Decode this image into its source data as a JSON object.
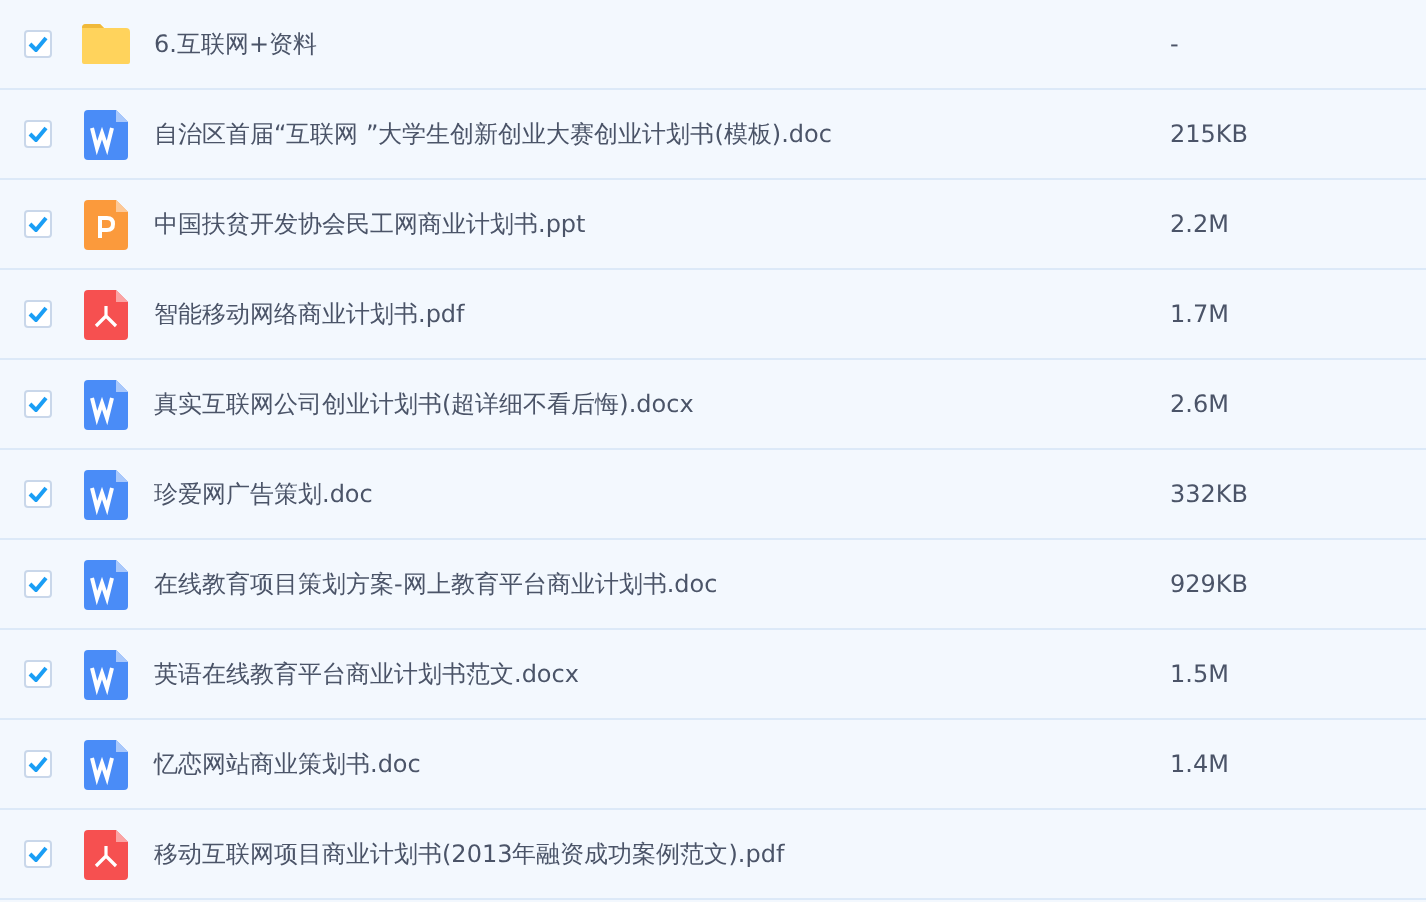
{
  "files": [
    {
      "kind": "folder",
      "name": "6.互联网+资料",
      "size": "-",
      "checked": true
    },
    {
      "kind": "word",
      "name": "自治区首届“互联网 ”大学生创新创业大赛创业计划书(模板).doc",
      "size": "215KB",
      "checked": true
    },
    {
      "kind": "ppt",
      "name": "中国扶贫开发协会民工网商业计划书.ppt",
      "size": "2.2M",
      "checked": true
    },
    {
      "kind": "pdf",
      "name": "智能移动网络商业计划书.pdf",
      "size": "1.7M",
      "checked": true
    },
    {
      "kind": "word",
      "name": "真实互联网公司创业计划书(超详细不看后悔).docx",
      "size": "2.6M",
      "checked": true
    },
    {
      "kind": "word",
      "name": "珍爱网广告策划.doc",
      "size": "332KB",
      "checked": true
    },
    {
      "kind": "word",
      "name": "在线教育项目策划方案-网上教育平台商业计划书.doc",
      "size": "929KB",
      "checked": true
    },
    {
      "kind": "word",
      "name": "英语在线教育平台商业计划书范文.docx",
      "size": "1.5M",
      "checked": true
    },
    {
      "kind": "word",
      "name": "忆恋网站商业策划书.doc",
      "size": "1.4M",
      "checked": true
    },
    {
      "kind": "pdf",
      "name": "移动互联网项目商业计划书(2013年融资成功案例范文).pdf",
      "checked": true
    }
  ]
}
